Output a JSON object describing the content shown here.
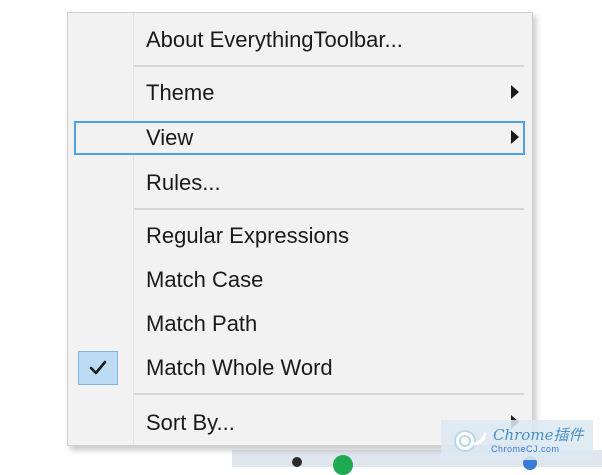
{
  "menu": {
    "about_label": "About EverythingToolbar...",
    "theme_label": "Theme",
    "view_label": "View",
    "rules_label": "Rules...",
    "regex_label": "Regular Expressions",
    "match_case_label": "Match Case",
    "match_path_label": "Match Path",
    "match_whole_word_label": "Match Whole Word",
    "match_whole_word_checked": true,
    "sort_by_label": "Sort By...",
    "highlighted_item": "View"
  },
  "watermark": {
    "title": "Chrome插件",
    "subtitle": "ChromeCJ.com"
  },
  "colors": {
    "menu_bg": "#f2f2f2",
    "highlight_border": "#4ea2df",
    "check_bg": "#bcdcf3"
  }
}
